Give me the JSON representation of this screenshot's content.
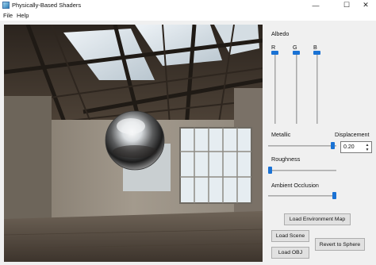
{
  "window": {
    "title": "Physically-Based Shaders",
    "minimize_glyph": "—",
    "maximize_glyph": "☐",
    "close_glyph": "✕"
  },
  "menu": {
    "items": [
      "File",
      "Help"
    ]
  },
  "panel": {
    "albedo_label": "Albedo",
    "channels": [
      {
        "label": "R",
        "value": 1.0
      },
      {
        "label": "G",
        "value": 1.0
      },
      {
        "label": "B",
        "value": 1.0
      }
    ],
    "metallic": {
      "label": "Metallic",
      "value": 0.97
    },
    "displacement": {
      "label": "Displacement",
      "value": "0.20"
    },
    "roughness": {
      "label": "Roughness",
      "value": 0.0
    },
    "ambient_occlusion": {
      "label": "Ambient Occlusion",
      "value": 1.0
    },
    "buttons": {
      "load_env": "Load Environment Map",
      "load_scene": "Load Scene",
      "revert": "Revert to Sphere",
      "load_obj": "Load OBJ"
    }
  },
  "colors": {
    "accent": "#1a72d4"
  }
}
